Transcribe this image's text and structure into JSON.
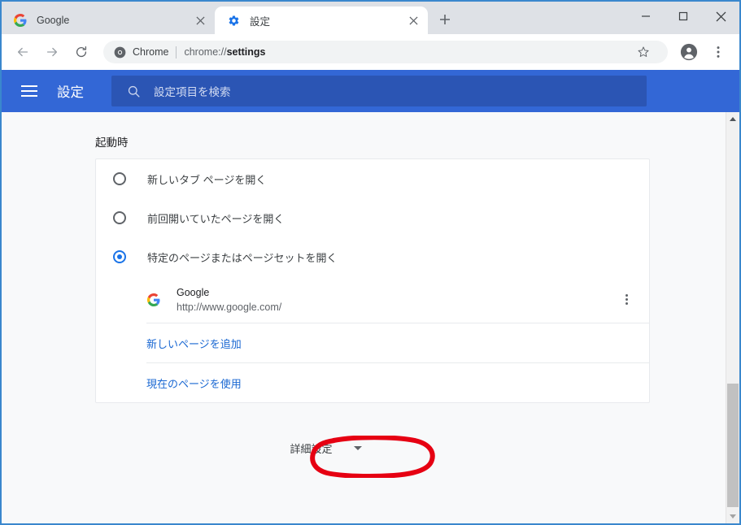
{
  "window": {
    "caption": {
      "minimize": "–",
      "maximize": "□",
      "close": "✕"
    }
  },
  "tabs": [
    {
      "title": "Google",
      "favicon": "google-g-icon",
      "active": false,
      "close": "✕"
    },
    {
      "title": "設定",
      "favicon": "gear-icon",
      "active": true,
      "close": "✕"
    }
  ],
  "newtab": {
    "label": "+"
  },
  "toolbar": {
    "back": "←",
    "forward": "→",
    "reload": "↻",
    "omnibox": {
      "scheme_chip": "Chrome",
      "url_prefix": "chrome://",
      "url_bold": "settings"
    },
    "bookmark": "☆",
    "profile": "profile-avatar-icon",
    "menu": "three-dot-menu-icon"
  },
  "settings_header": {
    "menu_button": "hamburger-icon",
    "title": "設定",
    "search": {
      "icon": "search-icon",
      "placeholder": "設定項目を検索",
      "value": ""
    }
  },
  "startup": {
    "section_title": "起動時",
    "options": [
      {
        "label": "新しいタブ ページを開く",
        "selected": false
      },
      {
        "label": "前回開いていたページを開く",
        "selected": false
      },
      {
        "label": "特定のページまたはページセットを開く",
        "selected": true
      }
    ],
    "pages": [
      {
        "favicon": "google-g-icon",
        "name": "Google",
        "url": "http://www.google.com/",
        "overflow": "more-options-icon"
      }
    ],
    "links": [
      {
        "label": "新しいページを追加"
      },
      {
        "label": "現在のページを使用"
      }
    ]
  },
  "advanced": {
    "label": "詳細設定",
    "chevron": "chevron-down-icon",
    "annotation_color": "#e60012"
  },
  "scrollbar": {
    "up": "▲",
    "down": "▼"
  },
  "colors": {
    "header_blue": "#3367d6",
    "search_blue": "#2b55b4",
    "accent_blue": "#1a73e8",
    "link_blue": "#1967d2",
    "window_border": "#3a87cd",
    "content_bg": "#f8f9fa"
  }
}
